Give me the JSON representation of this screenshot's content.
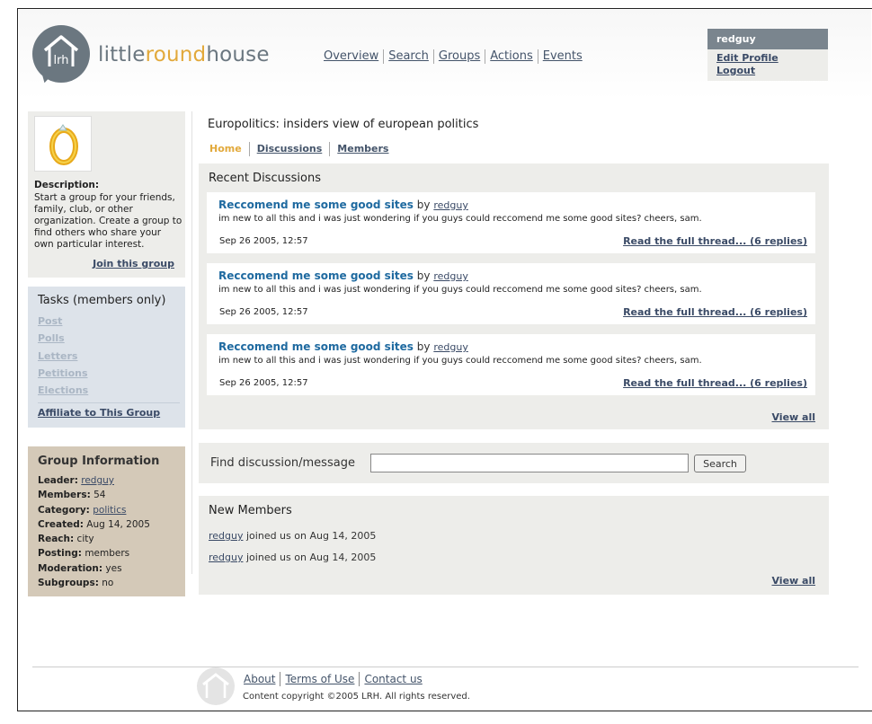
{
  "brand": {
    "part1": "little",
    "part2": "round",
    "part3": "house",
    "logo_initials": "lrh"
  },
  "topnav": [
    "Overview",
    "Search",
    "Groups",
    "Actions",
    "Events"
  ],
  "user": {
    "name": "redguy",
    "edit_profile": "Edit Profile",
    "logout": "Logout"
  },
  "sidebar": {
    "description_label": "Description:",
    "description_text": "Start a group for your friends, family, club, or other organization. Create a group to find others who share your own particular interest.",
    "join_link": "Join this group",
    "tasks_title": "Tasks",
    "tasks_note": "(members only)",
    "tasks": [
      "Post",
      "Polls",
      "Letters",
      "Petitions",
      "Elections"
    ],
    "affiliate": "Affiliate to This Group",
    "info_title": "Group Information",
    "info": {
      "leader_label": "Leader:",
      "leader": "redguy",
      "members_label": "Members:",
      "members": "54",
      "category_label": "Category:",
      "category": "politics",
      "created_label": "Created:",
      "created": "Aug 14, 2005",
      "reach_label": "Reach:",
      "reach": "city",
      "posting_label": "Posting:",
      "posting": "members",
      "moderation_label": "Moderation:",
      "moderation": "yes",
      "subgroups_label": "Subgroups:",
      "subgroups": "no"
    }
  },
  "group": {
    "title": "Europolitics: insiders view of european politics",
    "tabs": [
      "Home",
      "Discussions",
      "Members"
    ]
  },
  "recent": {
    "title": "Recent Discussions",
    "by": "by",
    "posts": [
      {
        "title": "Reccomend me some good sites",
        "author": "redguy",
        "body": "im new to all this and i was just wondering if you guys could reccomend me some good sites? cheers, sam.",
        "date": "Sep 26 2005, 12:57",
        "read": "Read the full thread... (6 replies)"
      },
      {
        "title": "Reccomend me some good sites",
        "author": "redguy",
        "body": "im new to all this and i was just wondering if you guys could reccomend me some good sites? cheers, sam.",
        "date": "Sep 26 2005, 12:57",
        "read": "Read the full thread... (6 replies)"
      },
      {
        "title": "Reccomend me some good sites",
        "author": "redguy",
        "body": "im new to all this and i was just wondering if you guys could reccomend me some good sites? cheers, sam.",
        "date": "Sep 26 2005, 12:57",
        "read": "Read the full thread... (6 replies)"
      }
    ],
    "view_all": "View all"
  },
  "find": {
    "label": "Find discussion/message",
    "value": "",
    "button": "Search"
  },
  "new_members": {
    "title": "New Members",
    "items": [
      {
        "name": "redguy",
        "text": "joined us on Aug 14, 2005"
      },
      {
        "name": "redguy",
        "text": "joined us on Aug 14, 2005"
      }
    ],
    "view_all": "View all"
  },
  "footer": {
    "links": [
      "About",
      "Terms of Use",
      "Contact us"
    ],
    "copyright": "Content copyright ©2005 LRH. All rights reserved."
  },
  "colors": {
    "brand_gray": "#6b7780",
    "brand_orange": "#e2a93b",
    "panel": "#ededea",
    "tasks_panel": "#dde3ea",
    "info_panel": "#d4c9b8",
    "post_title": "#1f6aa0"
  }
}
